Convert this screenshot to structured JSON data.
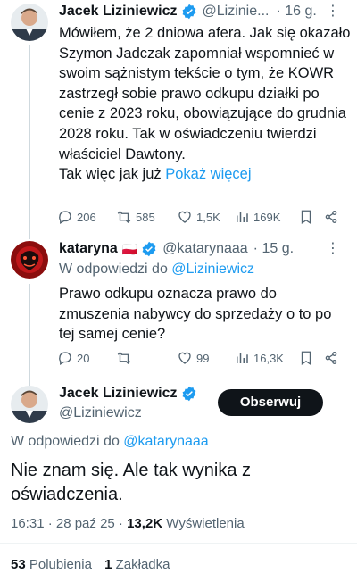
{
  "tweet1": {
    "name": "Jacek Liziniewicz",
    "handle": "@Lizinie...",
    "time": "· 16 g.",
    "text": "Mówiłem, że 2 dniowa afera. Jak się okazało Szymon Jadczak zapomniał wspomnieć w swoim sążnistym tekście o tym, że KOWR zastrzegł sobie prawo odkupu działki po cenie z 2023 roku, obowiązujące do grudnia 2028 roku. Tak w oświadczeniu twierdzi właściciel Dawtony.",
    "text_tail": "Tak więc jak już ",
    "show_more": "Pokaż więcej",
    "replies": "206",
    "reposts": "585",
    "likes": "1,5K",
    "views": "169K"
  },
  "tweet2": {
    "name": "kataryna",
    "flag": "🇵🇱",
    "handle": "@katarynaaa",
    "time": "· 15 g.",
    "replying_prefix": "W odpowiedzi do ",
    "replying_to": "@Liziniewicz",
    "text": "Prawo odkupu oznacza prawo do zmuszenia nabywcy do sprzedaży o to po tej samej cenie?",
    "replies": "20",
    "reposts": "",
    "likes": "99",
    "views": "16,3K"
  },
  "tweet3": {
    "name": "Jacek Liziniewicz",
    "handle": "@Liziniewicz",
    "follow_label": "Obserwuj",
    "replying_prefix": "W odpowiedzi do ",
    "replying_to": "@katarynaaa",
    "text": "Nie znam się. Ale tak wynika z oświadczenia.",
    "time": "16:31 · 28 paź 25 · ",
    "views_count": "13,2K",
    "views_label": " Wyświetlenia",
    "likes_count": "53",
    "likes_label": " Polubienia",
    "bookmarks_count": "1",
    "bookmarks_label": " Zakładka"
  },
  "colors": {
    "accent": "#1d9bf0",
    "muted": "#536471",
    "text": "#0f1419",
    "verified": "#1d9bf0"
  }
}
